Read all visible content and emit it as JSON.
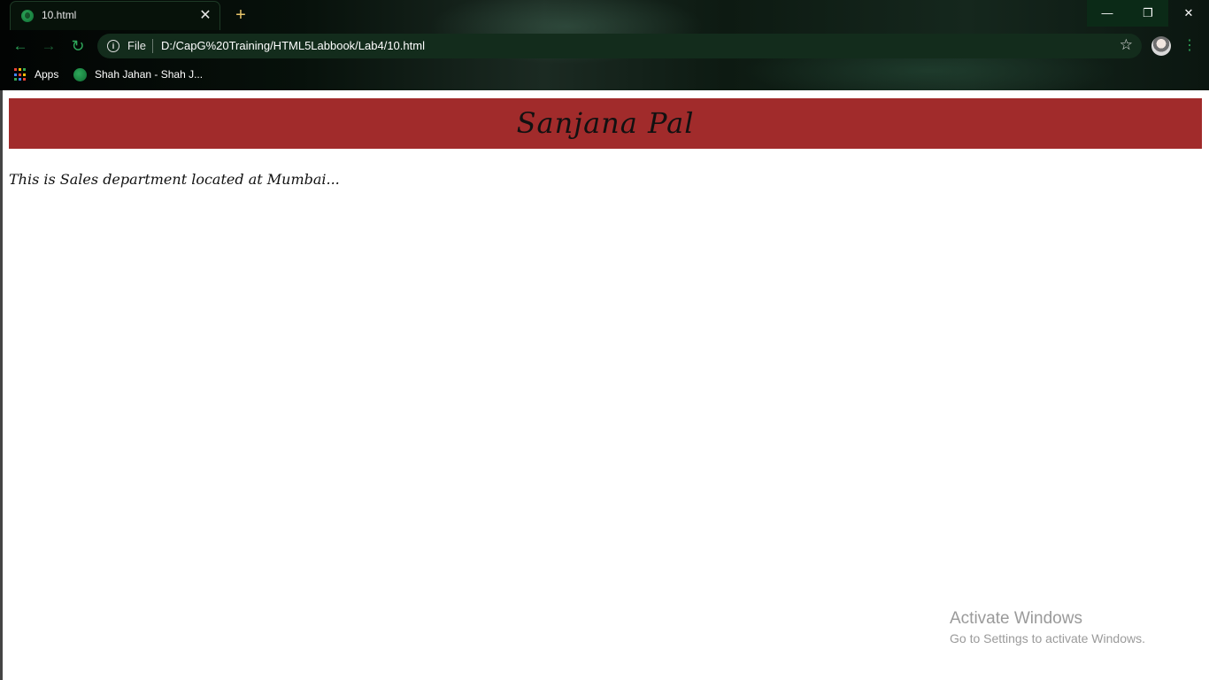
{
  "browser": {
    "tab": {
      "title": "10.html",
      "close_glyph": "✕"
    },
    "new_tab_glyph": "+",
    "window_controls": {
      "minimize": "—",
      "maximize": "❐",
      "close": "✕"
    },
    "address_bar": {
      "scheme_label": "File",
      "url": "D:/CapG%20Training/HTML5Labbook/Lab4/10.html"
    },
    "bookmarks": [
      {
        "label": "Apps"
      },
      {
        "label": "Shah Jahan - Shah J..."
      }
    ],
    "colors": {
      "accent": "#2ea85a"
    }
  },
  "page": {
    "heading": "Sanjana Pal",
    "paragraph": "This is Sales department located at Mumbai...",
    "header_color": "#a12b2b"
  },
  "watermark": {
    "title": "Activate Windows",
    "subtitle": "Go to Settings to activate Windows."
  }
}
